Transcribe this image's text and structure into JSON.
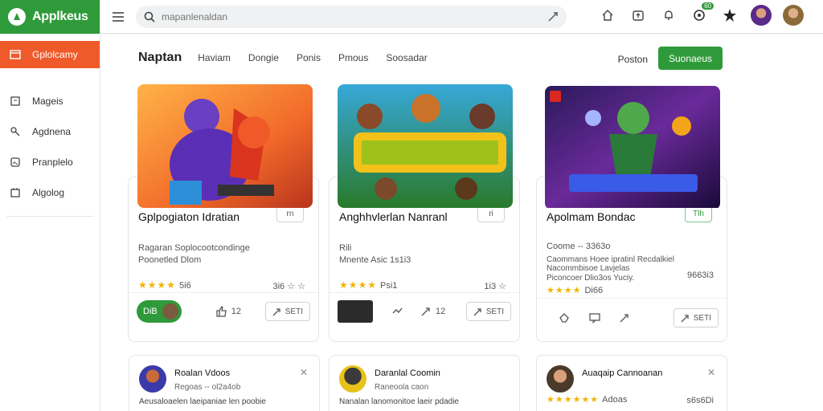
{
  "brand": {
    "title": "Applkeus"
  },
  "sidebar": {
    "active": {
      "label": "Gplolcamy",
      "icon": "window-icon"
    },
    "items": [
      {
        "label": "Mageis",
        "icon": "doc-icon"
      },
      {
        "label": "Agdnena",
        "icon": "key-icon"
      },
      {
        "label": "Pranplelo",
        "icon": "image-icon"
      },
      {
        "label": "Algolog",
        "icon": "calendar-icon"
      }
    ]
  },
  "search": {
    "placeholder": "mapanlenaldan"
  },
  "topbar": {
    "notif_badge": "60"
  },
  "nav": {
    "active_tab": "Naptan",
    "tabs": [
      "Haviam",
      "Dongie",
      "Ponis",
      "Pmous",
      "Soosadar"
    ],
    "right_link": "Poston",
    "cta_label": "Suonaeus"
  },
  "cards": [
    {
      "title": "Gplpogiaton Idratian",
      "tag": "rn",
      "line1": "Ragaran Soplocootcondinge",
      "line2": "Poonetled Dlom",
      "rating": "5i6",
      "right": "3i6 ☆ ☆",
      "pill": "DiB",
      "likes": "12",
      "action": "SETI"
    },
    {
      "title": "Anghhvlerlan Nanranl",
      "tag": "ri",
      "line1": "Rili",
      "line2": "Mnente Asic 1s1i3",
      "rating": "Psi1",
      "right": "1i3 ☆",
      "likes": "12",
      "action": "SETI"
    },
    {
      "title": "Apolmam Bondac",
      "tag": "Tlh",
      "line1": "Coome -- 3363o",
      "line2": "Caommans Hoee ipratinl Recdalkiel",
      "line3": "Nacommbisoe Lavjelas",
      "line4": "Piconcoer Dlio3os Yuciy.",
      "right": "9663i3",
      "rating": "Di66",
      "action": "SETI"
    }
  ],
  "small_cards": [
    {
      "title": "Roalan Vdoos",
      "line1": "Regoas -- ol2a4ob",
      "line2": "Aeusaloaelen laeipaniae len poobie"
    },
    {
      "title": "Daranlal Coomin",
      "line1": "Raneoola caon",
      "line2": "Nanalan lanomonitoe laeir pdadie"
    },
    {
      "title": "Auaqaip Cannoanan",
      "rating": "Adoas",
      "right": "s6s6Di"
    }
  ]
}
